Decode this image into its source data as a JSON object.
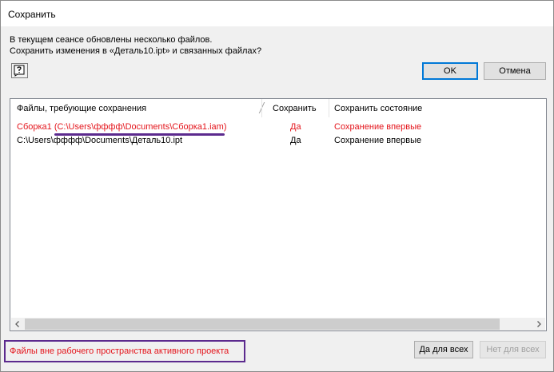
{
  "window": {
    "title": "Сохранить"
  },
  "message": {
    "line1": "В текущем сеансе обновлены несколько файлов.",
    "line2": "Сохранить изменения в «Деталь10.ipt» и связанных файлах?"
  },
  "buttons": {
    "ok": "OK",
    "cancel": "Отмена",
    "yes_all": "Да для всех",
    "no_all": "Нет для всех"
  },
  "table": {
    "columns": [
      "Файлы, требующие сохранения",
      "Сохранить",
      "Сохранить состояние"
    ],
    "rows": [
      {
        "file": "Сборка1 (C:\\Users\\фффф\\Documents\\Сборка1.iam)",
        "save": "Да",
        "state": "Сохранение впервые",
        "color": "#e4141b"
      },
      {
        "file": "C:\\Users\\фффф\\Documents\\Деталь10.ipt",
        "save": "Да",
        "state": "Сохранение впервые",
        "color": "#000000"
      }
    ]
  },
  "footer_note": "Файлы вне рабочего пространства активного проекта",
  "colors": {
    "accent": "#0078d7",
    "warning_text": "#e4141b",
    "annotation": "#5c2a8e"
  },
  "icons": {
    "help": "help-icon",
    "scroll_left": "chevron-left-icon",
    "scroll_right": "chevron-right-icon"
  }
}
